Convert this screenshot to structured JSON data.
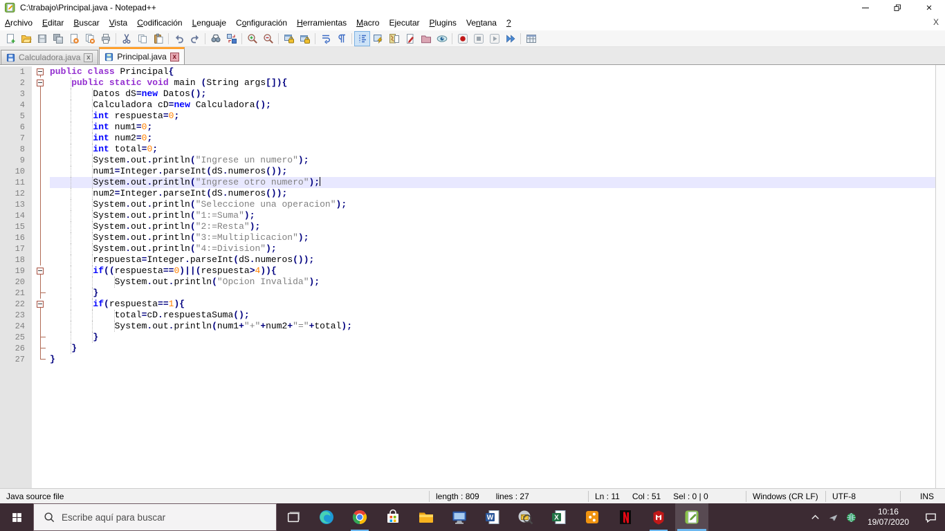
{
  "window": {
    "title": "C:\\trabajo\\Principal.java - Notepad++"
  },
  "menu": {
    "items": [
      {
        "label": "Archivo",
        "underline": 0
      },
      {
        "label": "Editar",
        "underline": 0
      },
      {
        "label": "Buscar",
        "underline": 0
      },
      {
        "label": "Vista",
        "underline": 0
      },
      {
        "label": "Codificación",
        "underline": 0
      },
      {
        "label": "Lenguaje",
        "underline": 0
      },
      {
        "label": "Configuración",
        "underline": 1
      },
      {
        "label": "Herramientas",
        "underline": 0
      },
      {
        "label": "Macro",
        "underline": 0
      },
      {
        "label": "Ejecutar",
        "underline": -1
      },
      {
        "label": "Plugins",
        "underline": 0
      },
      {
        "label": "Ventana",
        "underline": 2
      },
      {
        "label": "?",
        "underline": 0
      }
    ],
    "close_label": "X"
  },
  "toolbar": {
    "icons": [
      {
        "name": "new-file"
      },
      {
        "name": "open-folder"
      },
      {
        "name": "save"
      },
      {
        "name": "save-all"
      },
      {
        "name": "close"
      },
      {
        "name": "close-all"
      },
      {
        "name": "print"
      },
      {
        "name": "sep"
      },
      {
        "name": "cut"
      },
      {
        "name": "copy"
      },
      {
        "name": "paste"
      },
      {
        "name": "sep"
      },
      {
        "name": "undo"
      },
      {
        "name": "redo"
      },
      {
        "name": "sep"
      },
      {
        "name": "find"
      },
      {
        "name": "replace"
      },
      {
        "name": "sep"
      },
      {
        "name": "zoom-in"
      },
      {
        "name": "zoom-out"
      },
      {
        "name": "sep"
      },
      {
        "name": "sync-v-scroll"
      },
      {
        "name": "sync-h-scroll"
      },
      {
        "name": "sep"
      },
      {
        "name": "word-wrap"
      },
      {
        "name": "show-all-chars"
      },
      {
        "name": "sep"
      },
      {
        "name": "show-indent-guide",
        "pressed": true
      },
      {
        "name": "function-list"
      },
      {
        "name": "document-map"
      },
      {
        "name": "document-list"
      },
      {
        "name": "folder-workspace"
      },
      {
        "name": "monitoring-eye"
      },
      {
        "name": "sep"
      },
      {
        "name": "macro-record"
      },
      {
        "name": "macro-stop"
      },
      {
        "name": "macro-play"
      },
      {
        "name": "macro-run-multiple"
      },
      {
        "name": "sep"
      },
      {
        "name": "macro-save"
      }
    ]
  },
  "tabs": [
    {
      "label": "Calculadora.java",
      "active": false
    },
    {
      "label": "Principal.java",
      "active": true
    }
  ],
  "editor": {
    "current_line": 11,
    "caret_col": 51,
    "lines": [
      {
        "n": 1,
        "ind": 0,
        "fold": "box",
        "tokens": [
          [
            "public",
            "k"
          ],
          [
            " ",
            "d"
          ],
          [
            "class",
            "k"
          ],
          [
            " ",
            "d"
          ],
          [
            "Principal",
            "d"
          ],
          [
            "{",
            "o"
          ]
        ]
      },
      {
        "n": 2,
        "ind": 4,
        "fold": "box",
        "tokens": [
          [
            "public",
            "k"
          ],
          [
            " ",
            "d"
          ],
          [
            "static",
            "k"
          ],
          [
            " ",
            "d"
          ],
          [
            "void",
            "k"
          ],
          [
            " ",
            "d"
          ],
          [
            "main",
            "d"
          ],
          [
            " ",
            "d"
          ],
          [
            "(",
            "o"
          ],
          [
            "String",
            "d"
          ],
          [
            " ",
            "d"
          ],
          [
            "args",
            "d"
          ],
          [
            "[]){",
            "o"
          ]
        ]
      },
      {
        "n": 3,
        "ind": 8,
        "fold": "line",
        "tokens": [
          [
            "Datos",
            "d"
          ],
          [
            " ",
            "d"
          ],
          [
            "dS",
            "d"
          ],
          [
            "=",
            "o"
          ],
          [
            "new",
            "t"
          ],
          [
            " ",
            "d"
          ],
          [
            "Datos",
            "d"
          ],
          [
            "();",
            "o"
          ]
        ]
      },
      {
        "n": 4,
        "ind": 8,
        "fold": "line",
        "tokens": [
          [
            "Calculadora",
            "d"
          ],
          [
            " ",
            "d"
          ],
          [
            "cD",
            "d"
          ],
          [
            "=",
            "o"
          ],
          [
            "new",
            "t"
          ],
          [
            " ",
            "d"
          ],
          [
            "Calculadora",
            "d"
          ],
          [
            "();",
            "o"
          ]
        ]
      },
      {
        "n": 5,
        "ind": 8,
        "fold": "line",
        "tokens": [
          [
            "int",
            "t"
          ],
          [
            " ",
            "d"
          ],
          [
            "respuesta",
            "d"
          ],
          [
            "=",
            "o"
          ],
          [
            "0",
            "n"
          ],
          [
            ";",
            "o"
          ]
        ]
      },
      {
        "n": 6,
        "ind": 8,
        "fold": "line",
        "tokens": [
          [
            "int",
            "t"
          ],
          [
            " ",
            "d"
          ],
          [
            "num1",
            "d"
          ],
          [
            "=",
            "o"
          ],
          [
            "0",
            "n"
          ],
          [
            ";",
            "o"
          ]
        ]
      },
      {
        "n": 7,
        "ind": 8,
        "fold": "line",
        "tokens": [
          [
            "int",
            "t"
          ],
          [
            " ",
            "d"
          ],
          [
            "num2",
            "d"
          ],
          [
            "=",
            "o"
          ],
          [
            "0",
            "n"
          ],
          [
            ";",
            "o"
          ]
        ]
      },
      {
        "n": 8,
        "ind": 8,
        "fold": "line",
        "tokens": [
          [
            "int",
            "t"
          ],
          [
            " ",
            "d"
          ],
          [
            "total",
            "d"
          ],
          [
            "=",
            "o"
          ],
          [
            "0",
            "n"
          ],
          [
            ";",
            "o"
          ]
        ]
      },
      {
        "n": 9,
        "ind": 8,
        "fold": "line",
        "tokens": [
          [
            "System",
            "d"
          ],
          [
            ".",
            "o"
          ],
          [
            "out",
            "d"
          ],
          [
            ".",
            "o"
          ],
          [
            "println",
            "d"
          ],
          [
            "(",
            "o"
          ],
          [
            "\"Ingrese un numero\"",
            "s"
          ],
          [
            ");",
            "o"
          ]
        ]
      },
      {
        "n": 10,
        "ind": 8,
        "fold": "line",
        "tokens": [
          [
            "num1",
            "d"
          ],
          [
            "=",
            "o"
          ],
          [
            "Integer",
            "d"
          ],
          [
            ".",
            "o"
          ],
          [
            "parseInt",
            "d"
          ],
          [
            "(",
            "o"
          ],
          [
            "dS",
            "d"
          ],
          [
            ".",
            "o"
          ],
          [
            "numeros",
            "d"
          ],
          [
            "());",
            "o"
          ]
        ]
      },
      {
        "n": 11,
        "ind": 8,
        "fold": "line",
        "current": true,
        "caret": true,
        "tokens": [
          [
            "System",
            "d"
          ],
          [
            ".",
            "o"
          ],
          [
            "out",
            "d"
          ],
          [
            ".",
            "o"
          ],
          [
            "println",
            "d"
          ],
          [
            "(",
            "o"
          ],
          [
            "\"Ingrese otro numero\"",
            "s"
          ],
          [
            ");",
            "o"
          ]
        ]
      },
      {
        "n": 12,
        "ind": 8,
        "fold": "line",
        "tokens": [
          [
            "num2",
            "d"
          ],
          [
            "=",
            "o"
          ],
          [
            "Integer",
            "d"
          ],
          [
            ".",
            "o"
          ],
          [
            "parseInt",
            "d"
          ],
          [
            "(",
            "o"
          ],
          [
            "dS",
            "d"
          ],
          [
            ".",
            "o"
          ],
          [
            "numeros",
            "d"
          ],
          [
            "());",
            "o"
          ]
        ]
      },
      {
        "n": 13,
        "ind": 8,
        "fold": "line",
        "tokens": [
          [
            "System",
            "d"
          ],
          [
            ".",
            "o"
          ],
          [
            "out",
            "d"
          ],
          [
            ".",
            "o"
          ],
          [
            "println",
            "d"
          ],
          [
            "(",
            "o"
          ],
          [
            "\"Seleccione una operacion\"",
            "s"
          ],
          [
            ");",
            "o"
          ]
        ]
      },
      {
        "n": 14,
        "ind": 8,
        "fold": "line",
        "tokens": [
          [
            "System",
            "d"
          ],
          [
            ".",
            "o"
          ],
          [
            "out",
            "d"
          ],
          [
            ".",
            "o"
          ],
          [
            "println",
            "d"
          ],
          [
            "(",
            "o"
          ],
          [
            "\"1:=Suma\"",
            "s"
          ],
          [
            ");",
            "o"
          ]
        ]
      },
      {
        "n": 15,
        "ind": 8,
        "fold": "line",
        "tokens": [
          [
            "System",
            "d"
          ],
          [
            ".",
            "o"
          ],
          [
            "out",
            "d"
          ],
          [
            ".",
            "o"
          ],
          [
            "println",
            "d"
          ],
          [
            "(",
            "o"
          ],
          [
            "\"2:=Resta\"",
            "s"
          ],
          [
            ");",
            "o"
          ]
        ]
      },
      {
        "n": 16,
        "ind": 8,
        "fold": "line",
        "tokens": [
          [
            "System",
            "d"
          ],
          [
            ".",
            "o"
          ],
          [
            "out",
            "d"
          ],
          [
            ".",
            "o"
          ],
          [
            "println",
            "d"
          ],
          [
            "(",
            "o"
          ],
          [
            "\"3:=Multiplicacion\"",
            "s"
          ],
          [
            ");",
            "o"
          ]
        ]
      },
      {
        "n": 17,
        "ind": 8,
        "fold": "line",
        "tokens": [
          [
            "System",
            "d"
          ],
          [
            ".",
            "o"
          ],
          [
            "out",
            "d"
          ],
          [
            ".",
            "o"
          ],
          [
            "println",
            "d"
          ],
          [
            "(",
            "o"
          ],
          [
            "\"4:=Division\"",
            "s"
          ],
          [
            ");",
            "o"
          ]
        ]
      },
      {
        "n": 18,
        "ind": 8,
        "fold": "line",
        "tokens": [
          [
            "respuesta",
            "d"
          ],
          [
            "=",
            "o"
          ],
          [
            "Integer",
            "d"
          ],
          [
            ".",
            "o"
          ],
          [
            "parseInt",
            "d"
          ],
          [
            "(",
            "o"
          ],
          [
            "dS",
            "d"
          ],
          [
            ".",
            "o"
          ],
          [
            "numeros",
            "d"
          ],
          [
            "());",
            "o"
          ]
        ]
      },
      {
        "n": 19,
        "ind": 8,
        "fold": "box",
        "tokens": [
          [
            "if",
            "t"
          ],
          [
            "((",
            "o"
          ],
          [
            "respuesta",
            "d"
          ],
          [
            "==",
            "o"
          ],
          [
            "0",
            "n"
          ],
          [
            ")",
            "o"
          ],
          [
            "||",
            "o"
          ],
          [
            "(",
            "o"
          ],
          [
            "respuesta",
            "d"
          ],
          [
            ">",
            "o"
          ],
          [
            "4",
            "n"
          ],
          [
            ")){",
            "o"
          ]
        ]
      },
      {
        "n": 20,
        "ind": 12,
        "fold": "line",
        "tokens": [
          [
            "System",
            "d"
          ],
          [
            ".",
            "o"
          ],
          [
            "out",
            "d"
          ],
          [
            ".",
            "o"
          ],
          [
            "println",
            "d"
          ],
          [
            "(",
            "o"
          ],
          [
            "\"Opcion Invalida\"",
            "s"
          ],
          [
            ");",
            "o"
          ]
        ]
      },
      {
        "n": 21,
        "ind": 8,
        "fold": "tee",
        "tokens": [
          [
            "}",
            "o"
          ]
        ]
      },
      {
        "n": 22,
        "ind": 8,
        "fold": "box",
        "tokens": [
          [
            "if",
            "t"
          ],
          [
            "(",
            "o"
          ],
          [
            "respuesta",
            "d"
          ],
          [
            "==",
            "o"
          ],
          [
            "1",
            "n"
          ],
          [
            "){",
            "o"
          ]
        ]
      },
      {
        "n": 23,
        "ind": 12,
        "fold": "line",
        "tokens": [
          [
            "total",
            "d"
          ],
          [
            "=",
            "o"
          ],
          [
            "cD",
            "d"
          ],
          [
            ".",
            "o"
          ],
          [
            "respuestaSuma",
            "d"
          ],
          [
            "();",
            "o"
          ]
        ]
      },
      {
        "n": 24,
        "ind": 12,
        "fold": "line",
        "tokens": [
          [
            "System",
            "d"
          ],
          [
            ".",
            "o"
          ],
          [
            "out",
            "d"
          ],
          [
            ".",
            "o"
          ],
          [
            "println",
            "d"
          ],
          [
            "(",
            "o"
          ],
          [
            "num1",
            "d"
          ],
          [
            "+",
            "o"
          ],
          [
            "\"+\"",
            "s"
          ],
          [
            "+",
            "o"
          ],
          [
            "num2",
            "d"
          ],
          [
            "+",
            "o"
          ],
          [
            "\"=\"",
            "s"
          ],
          [
            "+",
            "o"
          ],
          [
            "total",
            "d"
          ],
          [
            ");",
            "o"
          ]
        ]
      },
      {
        "n": 25,
        "ind": 8,
        "fold": "tee",
        "tokens": [
          [
            "}",
            "o"
          ]
        ]
      },
      {
        "n": 26,
        "ind": 4,
        "fold": "tee",
        "tokens": [
          [
            "}",
            "o"
          ]
        ]
      },
      {
        "n": 27,
        "ind": 0,
        "fold": "end",
        "tokens": [
          [
            "}",
            "o"
          ]
        ]
      }
    ]
  },
  "status": {
    "doc_type": "Java source file",
    "length": "length : 809",
    "lines": "lines : 27",
    "ln": "Ln : 11",
    "col": "Col : 51",
    "sel": "Sel : 0 | 0",
    "eol": "Windows (CR LF)",
    "encoding": "UTF-8",
    "typing_mode": "INS"
  },
  "taskbar": {
    "search_placeholder": "Escribe aquí para buscar",
    "apps": [
      {
        "name": "edge"
      },
      {
        "name": "chrome",
        "running": true
      },
      {
        "name": "microsoft-store"
      },
      {
        "name": "file-explorer"
      },
      {
        "name": "computer"
      },
      {
        "name": "word"
      },
      {
        "name": "mail-search"
      },
      {
        "name": "excel"
      },
      {
        "name": "orange-dots-app"
      },
      {
        "name": "netflix"
      },
      {
        "name": "mcafee",
        "running": true
      },
      {
        "name": "notepad-plus-plus",
        "active": true
      }
    ],
    "tray": {
      "time": "10:16",
      "date": "19/07/2020"
    }
  },
  "colors": {
    "accent_orange_tab": "#ffa12e",
    "current_line": "#e8e8ff",
    "keyword_purple": "#9430d0",
    "keyword_blue": "#0000ff",
    "number_orange": "#ff8000",
    "string_grey": "#808080",
    "operator_navy": "#000080",
    "taskbar_bg": "#3c2b33",
    "running_underline": "#6cb8f0"
  }
}
